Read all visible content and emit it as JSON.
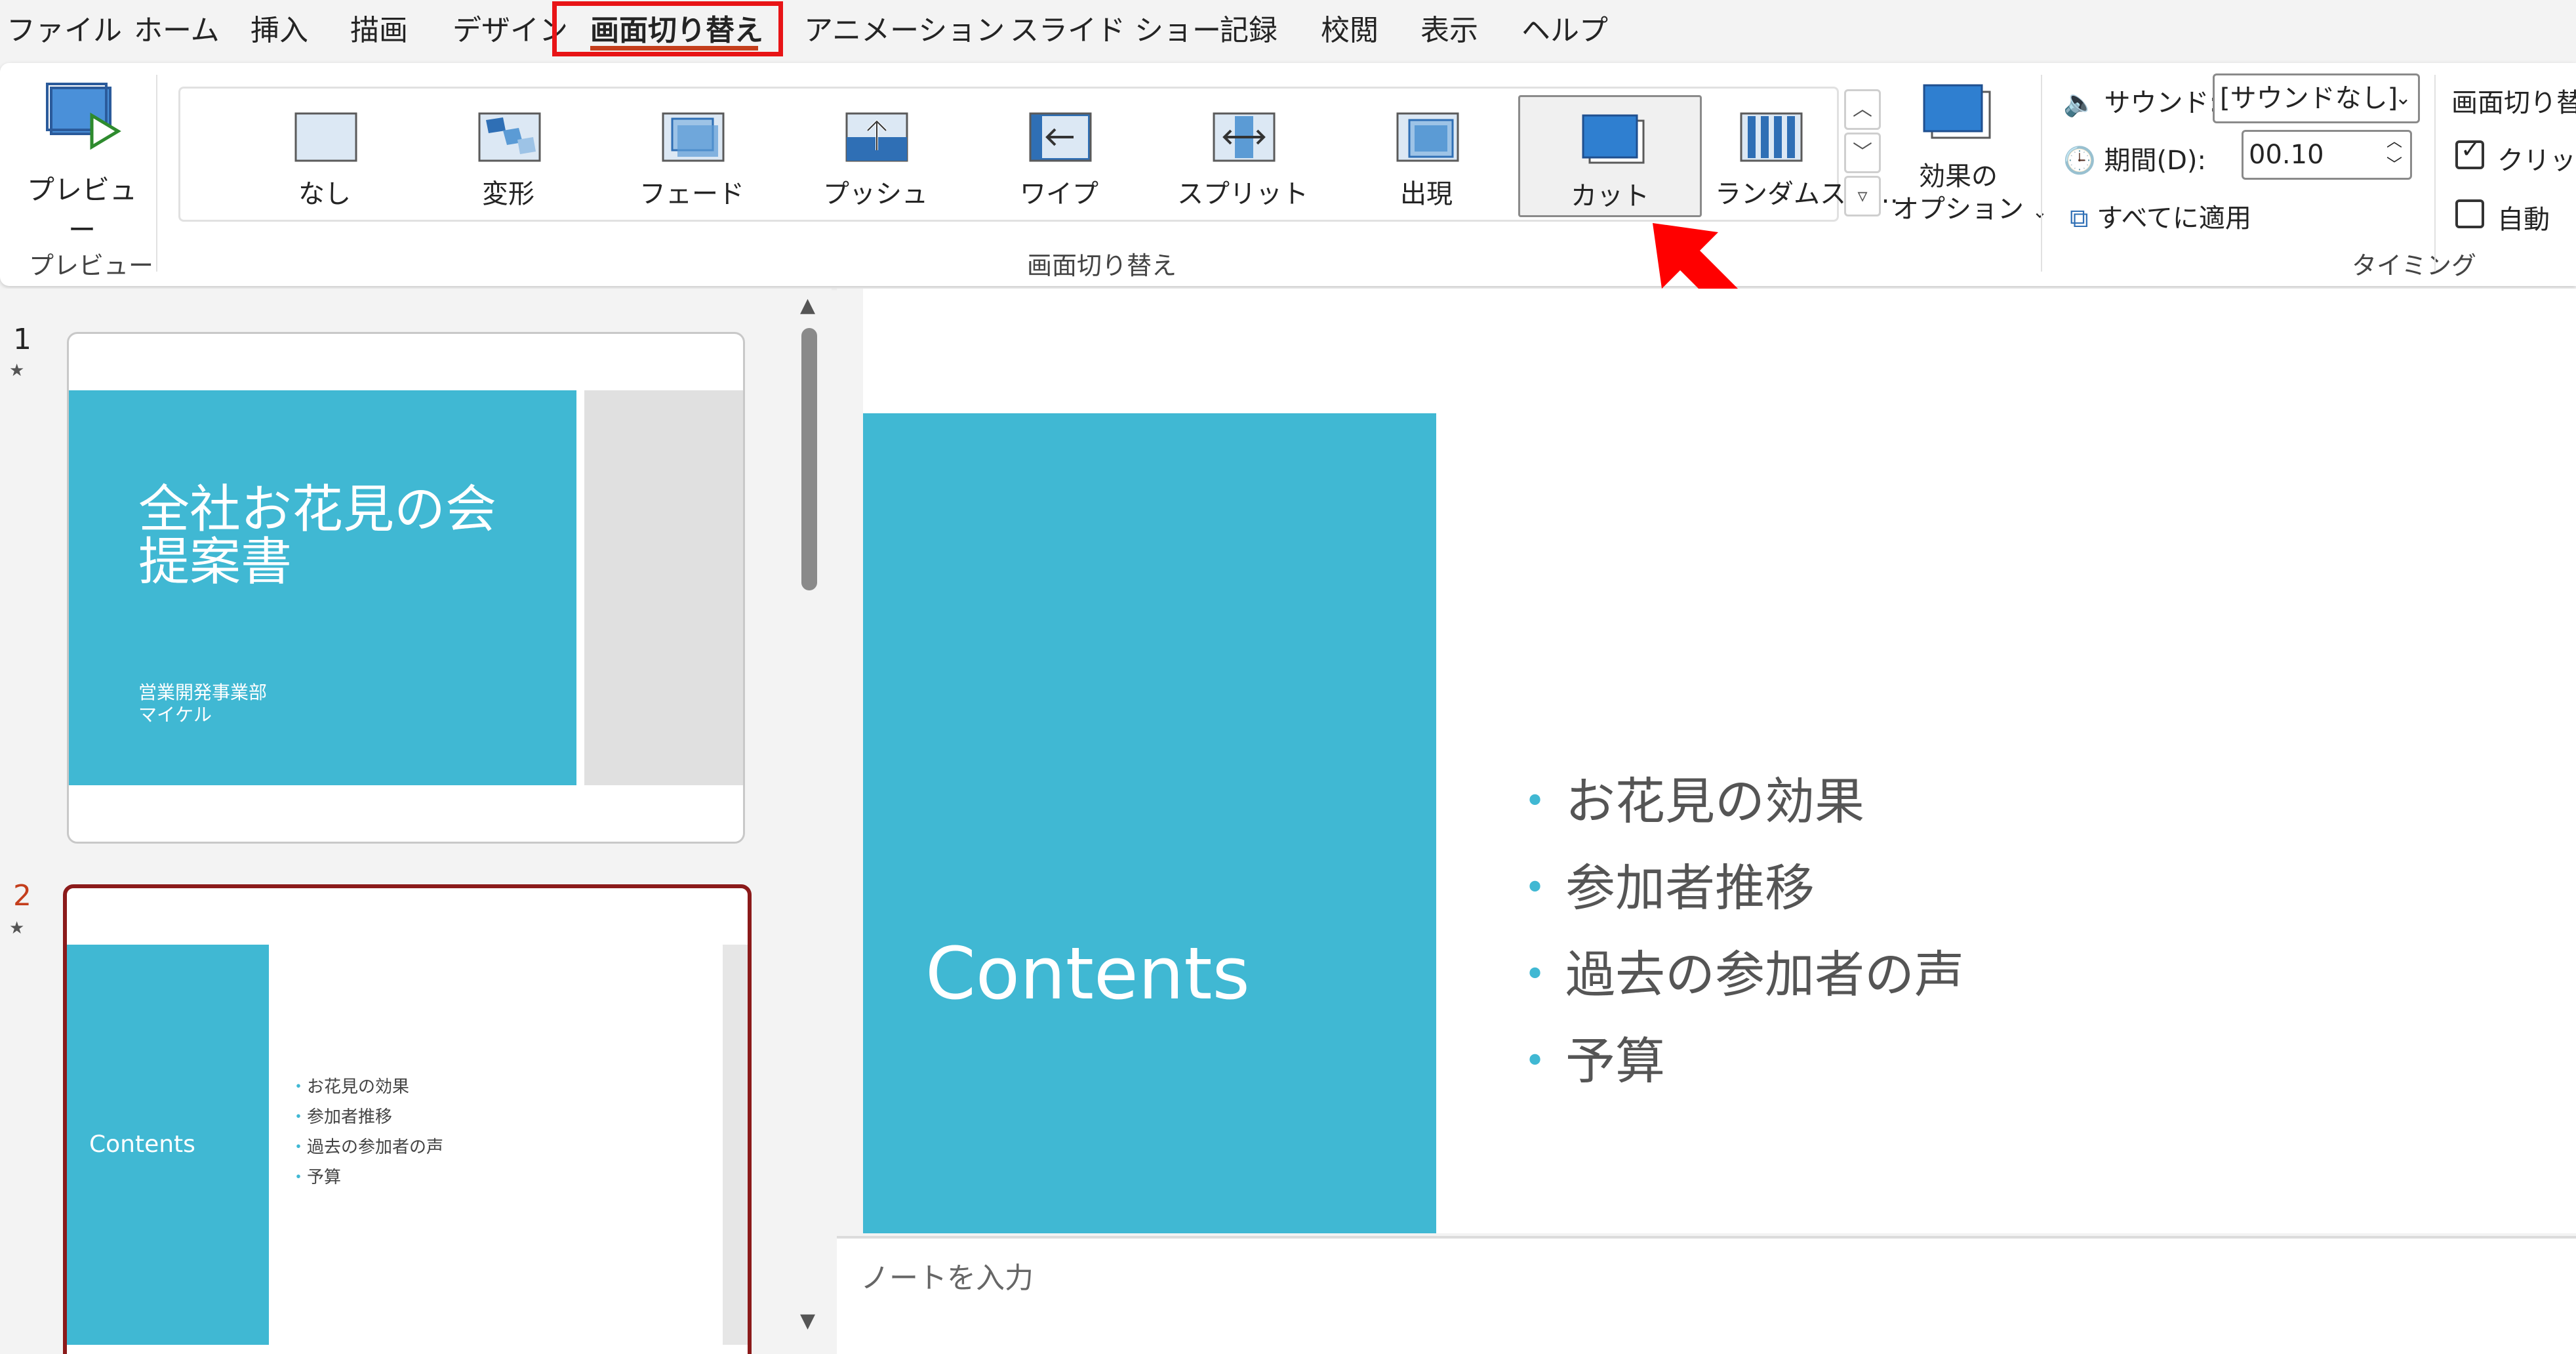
{
  "menu": {
    "file": "ファイル",
    "home": "ホーム",
    "insert": "挿入",
    "draw": "描画",
    "design": "デザイン",
    "transitions": "画面切り替え",
    "animations": "アニメーション",
    "slideshow": "スライド ショー",
    "record": "記録",
    "review": "校閲",
    "view": "表示",
    "help": "ヘルプ"
  },
  "ribbon": {
    "preview_label": "プレビュー",
    "preview_group": "プレビュー",
    "transitions_group": "画面切り替え",
    "timing_group": "タイミング",
    "gallery": [
      {
        "label": "なし",
        "icon": "none-transition-icon"
      },
      {
        "label": "変形",
        "icon": "morph-transition-icon"
      },
      {
        "label": "フェード",
        "icon": "fade-transition-icon"
      },
      {
        "label": "プッシュ",
        "icon": "push-transition-icon"
      },
      {
        "label": "ワイプ",
        "icon": "wipe-transition-icon"
      },
      {
        "label": "スプリット",
        "icon": "split-transition-icon"
      },
      {
        "label": "出現",
        "icon": "reveal-transition-icon"
      },
      {
        "label": "カット",
        "icon": "cut-transition-icon"
      },
      {
        "label": "ランダムスト…",
        "icon": "random-bars-transition-icon"
      }
    ],
    "options_line1": "効果の",
    "options_line2": "オプション",
    "sound_label": "サウンド:",
    "sound_value": "[サウンドなし]",
    "duration_label": "期間(D):",
    "duration_value": "00.10",
    "apply_all": "すべてに適用",
    "advance_header": "画面切り替",
    "on_click": "クリック時",
    "auto": "自動"
  },
  "slides": [
    {
      "number": "1",
      "title_line1": "全社お花見の会",
      "title_line2": "提案書",
      "sub_line1": "営業開発事業部",
      "sub_line2": "マイケル"
    },
    {
      "number": "2",
      "title": "Contents",
      "bullets": [
        "お花見の効果",
        "参加者推移",
        "過去の参加者の声",
        "予算"
      ]
    }
  ],
  "main_slide": {
    "title": "Contents",
    "bullets": [
      "お花見の効果",
      "参加者推移",
      "過去の参加者の声",
      "予算"
    ]
  },
  "notes_placeholder": "ノートを入力",
  "colors": {
    "accent_teal": "#40b8d3",
    "highlight_red": "#e81416",
    "selected_slide_border": "#8b1a1a"
  }
}
